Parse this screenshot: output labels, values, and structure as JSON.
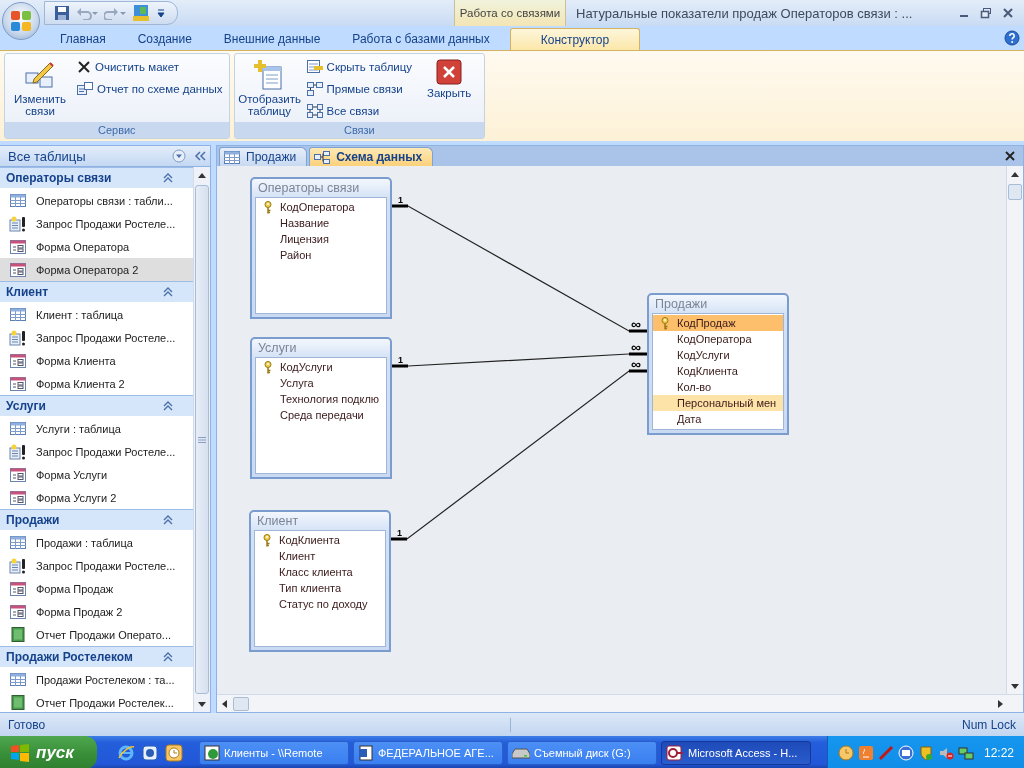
{
  "window": {
    "title": "Натуральные показатели продаж Операторов связи : ...",
    "context_tab_group": "Работа со связями"
  },
  "ribbon_tabs": [
    {
      "label": "Главная",
      "selected": false
    },
    {
      "label": "Создание",
      "selected": false
    },
    {
      "label": "Внешние данные",
      "selected": false
    },
    {
      "label": "Работа с базами данных",
      "selected": false
    },
    {
      "label": "Конструктор",
      "selected": true
    }
  ],
  "ribbon_groups": [
    {
      "label": "Сервис",
      "items": [
        {
          "kind": "large",
          "label": "Изменить связи"
        },
        {
          "kind": "small",
          "label": "Очистить макет"
        },
        {
          "kind": "small",
          "label": "Отчет по схеме данных"
        }
      ]
    },
    {
      "label": "Связи",
      "items": [
        {
          "kind": "large",
          "label": "Отобразить таблицу"
        },
        {
          "kind": "small",
          "label": "Скрыть таблицу"
        },
        {
          "kind": "small",
          "label": "Прямые связи"
        },
        {
          "kind": "small",
          "label": "Все связи"
        },
        {
          "kind": "large",
          "label": "Закрыть"
        }
      ]
    }
  ],
  "navigation_pane": {
    "title": "Все таблицы",
    "groups": [
      {
        "title": "Операторы связи",
        "items": [
          {
            "kind": "table",
            "label": "Операторы связи : табли...",
            "selected": false
          },
          {
            "kind": "query",
            "label": "Запрос Продажи Ростеле...",
            "selected": false
          },
          {
            "kind": "form",
            "label": "Форма Оператора",
            "selected": false
          },
          {
            "kind": "form",
            "label": "Форма Оператора 2",
            "selected": true
          }
        ]
      },
      {
        "title": "Клиент",
        "items": [
          {
            "kind": "table",
            "label": "Клиент : таблица",
            "selected": false
          },
          {
            "kind": "query",
            "label": "Запрос Продажи Ростеле...",
            "selected": false
          },
          {
            "kind": "form",
            "label": "Форма Клиента",
            "selected": false
          },
          {
            "kind": "form",
            "label": "Форма Клиента 2",
            "selected": false
          }
        ]
      },
      {
        "title": "Услуги",
        "items": [
          {
            "kind": "table",
            "label": "Услуги : таблица",
            "selected": false
          },
          {
            "kind": "query",
            "label": "Запрос Продажи Ростеле...",
            "selected": false
          },
          {
            "kind": "form",
            "label": "Форма Услуги",
            "selected": false
          },
          {
            "kind": "form",
            "label": "Форма Услуги 2",
            "selected": false
          }
        ]
      },
      {
        "title": "Продажи",
        "items": [
          {
            "kind": "table",
            "label": "Продажи : таблица",
            "selected": false
          },
          {
            "kind": "query",
            "label": "Запрос Продажи Ростеле...",
            "selected": false
          },
          {
            "kind": "form",
            "label": "Форма Продаж",
            "selected": false
          },
          {
            "kind": "form",
            "label": "Форма Продаж 2",
            "selected": false
          },
          {
            "kind": "report",
            "label": "Отчет Продажи Операто...",
            "selected": false
          }
        ]
      },
      {
        "title": "Продажи Ростелеком",
        "items": [
          {
            "kind": "table",
            "label": "Продажи Ростелеком : та...",
            "selected": false
          },
          {
            "kind": "report",
            "label": "Отчет Продажи Ростелек...",
            "selected": false
          }
        ]
      }
    ]
  },
  "document_tabs": [
    {
      "kind": "table",
      "label": "Продажи",
      "selected": false
    },
    {
      "kind": "diagram",
      "label": "Схема данных",
      "selected": true
    }
  ],
  "diagram": {
    "tables": [
      {
        "title": "Операторы связи",
        "fields": [
          {
            "name": "КодОператора",
            "key": true,
            "selected": false,
            "highlighted": false
          },
          {
            "name": "Название",
            "key": false,
            "selected": false,
            "highlighted": false
          },
          {
            "name": "Лицензия",
            "key": false,
            "selected": false,
            "highlighted": false
          },
          {
            "name": "Район",
            "key": false,
            "selected": false,
            "highlighted": false
          }
        ]
      },
      {
        "title": "Услуги",
        "fields": [
          {
            "name": "КодУслуги",
            "key": true,
            "selected": false,
            "highlighted": false
          },
          {
            "name": "Услуга",
            "key": false,
            "selected": false,
            "highlighted": false
          },
          {
            "name": "Технология подклю",
            "key": false,
            "selected": false,
            "highlighted": false
          },
          {
            "name": "Среда передачи",
            "key": false,
            "selected": false,
            "highlighted": false
          }
        ]
      },
      {
        "title": "Клиент",
        "fields": [
          {
            "name": "КодКлиента",
            "key": true,
            "selected": false,
            "highlighted": false
          },
          {
            "name": "Клиент",
            "key": false,
            "selected": false,
            "highlighted": false
          },
          {
            "name": "Класс клиента",
            "key": false,
            "selected": false,
            "highlighted": false
          },
          {
            "name": "Тип клиента",
            "key": false,
            "selected": false,
            "highlighted": false
          },
          {
            "name": "Статус по доходу",
            "key": false,
            "selected": false,
            "highlighted": false
          }
        ]
      },
      {
        "title": "Продажи",
        "fields": [
          {
            "name": "КодПродаж",
            "key": true,
            "selected": true,
            "highlighted": false
          },
          {
            "name": "КодОператора",
            "key": false,
            "selected": false,
            "highlighted": false
          },
          {
            "name": "КодУслуги",
            "key": false,
            "selected": false,
            "highlighted": false
          },
          {
            "name": "КодКлиента",
            "key": false,
            "selected": false,
            "highlighted": false
          },
          {
            "name": "Кол-во",
            "key": false,
            "selected": false,
            "highlighted": false
          },
          {
            "name": "Персональный мен",
            "key": false,
            "selected": false,
            "highlighted": true
          },
          {
            "name": "Дата",
            "key": false,
            "selected": false,
            "highlighted": false
          }
        ]
      }
    ],
    "relations": [
      {
        "one": "1",
        "many": "∞"
      },
      {
        "one": "1",
        "many": "∞"
      },
      {
        "one": "1",
        "many": "∞"
      }
    ]
  },
  "status_bar": {
    "status": "Готово",
    "indicator": "Num Lock"
  },
  "taskbar": {
    "start": "пуск",
    "tasks": [
      {
        "kind": "app",
        "label": "Клиенты - \\\\Remote",
        "selected": false
      },
      {
        "kind": "word",
        "label": "ФЕДЕРАЛЬНОЕ АГЕ...",
        "selected": false
      },
      {
        "kind": "drive",
        "label": "Съемный диск (G:)",
        "selected": false
      },
      {
        "kind": "access",
        "label": "Microsoft Access - Н...",
        "selected": true
      }
    ],
    "clock": "12:22"
  }
}
